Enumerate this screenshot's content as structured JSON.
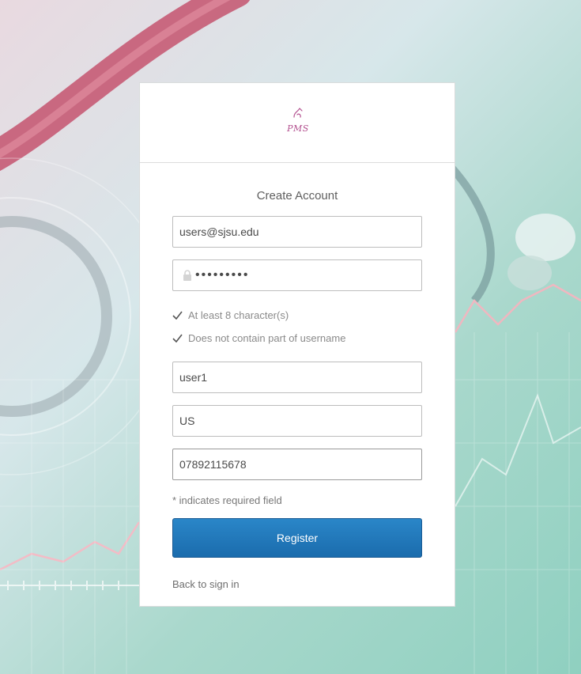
{
  "header": {
    "logo_text": "PMS"
  },
  "form": {
    "title": "Create Account",
    "email_value": "users@sjsu.edu",
    "password_value": "•••••••••",
    "rules": [
      "At least 8 character(s)",
      "Does not contain part of username"
    ],
    "username_value": "user1",
    "country_value": "US",
    "phone_value": "07892115678",
    "required_note": "* indicates required field",
    "register_label": "Register",
    "back_link": "Back to sign in"
  },
  "colors": {
    "primary_button": "#1b6cad",
    "logo": "#b3508f",
    "check": "#555555"
  },
  "icons": [
    "logo-icon",
    "lock-icon",
    "check-icon"
  ]
}
